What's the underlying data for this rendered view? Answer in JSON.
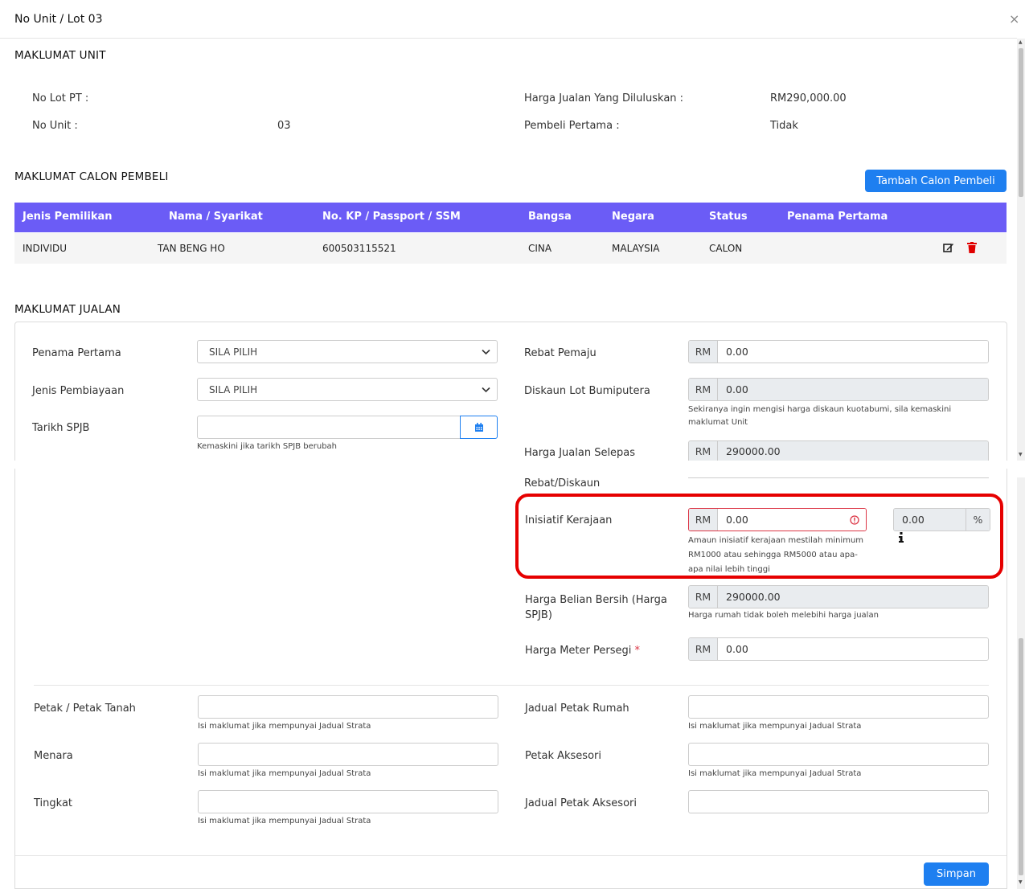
{
  "modal": {
    "title": "No Unit / Lot 03",
    "close": "×"
  },
  "unit": {
    "section_title": "MAKLUMAT UNIT",
    "lot_pt_label": "No Lot PT :",
    "lot_pt_value": "",
    "unit_label": "No Unit :",
    "unit_value": "03",
    "harga_label": "Harga Jualan Yang Diluluskan :",
    "harga_value": "RM290,000.00",
    "pembeli_label": "Pembeli Pertama :",
    "pembeli_value": "Tidak"
  },
  "buyers": {
    "section_title": "MAKLUMAT CALON PEMBELI",
    "add_button": "Tambah Calon Pembeli",
    "columns": [
      "Jenis Pemilikan",
      "Nama / Syarikat",
      "No. KP / Passport / SSM",
      "Bangsa",
      "Negara",
      "Status",
      "Penama Pertama"
    ],
    "rows": [
      [
        "INDIVIDU",
        "TAN BENG HO",
        "600503115521",
        "CINA",
        "MALAYSIA",
        "CALON",
        ""
      ]
    ]
  },
  "sale": {
    "section_title": "MAKLUMAT JUALAN",
    "penama_label": "Penama Pertama",
    "penama_value": "SILA PILIH",
    "jenis_label": "Jenis Pembiayaan",
    "jenis_value": "SILA PILIH",
    "tarikh_label": "Tarikh SPJB",
    "tarikh_value": "",
    "tarikh_help": "Kemaskini jika tarikh SPJB berubah",
    "rebat_label": "Rebat Pemaju",
    "rebat_value": "0.00",
    "diskaun_label": "Diskaun Lot Bumiputera",
    "diskaun_value": "0.00",
    "diskaun_help": "Sekiranya ingin mengisi harga diskaun kuotabumi, sila kemaskini maklumat Unit",
    "selepas_label_1": "Harga Jualan Selepas",
    "selepas_label_2": "Rebat/Diskaun",
    "selepas_value": "290000.00",
    "inisiatif_label": "Inisiatif Kerajaan",
    "inisiatif_value": "0.00",
    "inisiatif_pct": "0.00",
    "inisiatif_pct_unit": "%",
    "inisiatif_err_1": "Amaun inisiatif kerajaan mestilah minimum",
    "inisiatif_err_2": "RM1000 atau sehingga RM5000 atau apa-",
    "inisiatif_err_3": "apa nilai lebih tinggi",
    "bersih_label_1": "Harga Belian Bersih (Harga",
    "bersih_label_2": "SPJB)",
    "bersih_value": "290000.00",
    "bersih_help": "Harga rumah tidak boleh melebihi harga jualan",
    "meter_label": "Harga Meter Persegi",
    "meter_required": "*",
    "meter_value": "0.00",
    "currency": "RM"
  },
  "strata": {
    "petak_label": "Petak / Petak Tanah",
    "menara_label": "Menara",
    "tingkat_label": "Tingkat",
    "rumah_label": "Jadual Petak Rumah",
    "aksesori_label": "Petak Aksesori",
    "jadual_aksesori_label": "Jadual Petak Aksesori",
    "help": "Isi maklumat jika mempunyai Jadual Strata"
  },
  "footer": {
    "save": "Simpan"
  },
  "colors": {
    "primary": "#1e7ff0",
    "table_header": "#6b5cf6",
    "error": "#dc3545",
    "highlight": "#e60000"
  }
}
